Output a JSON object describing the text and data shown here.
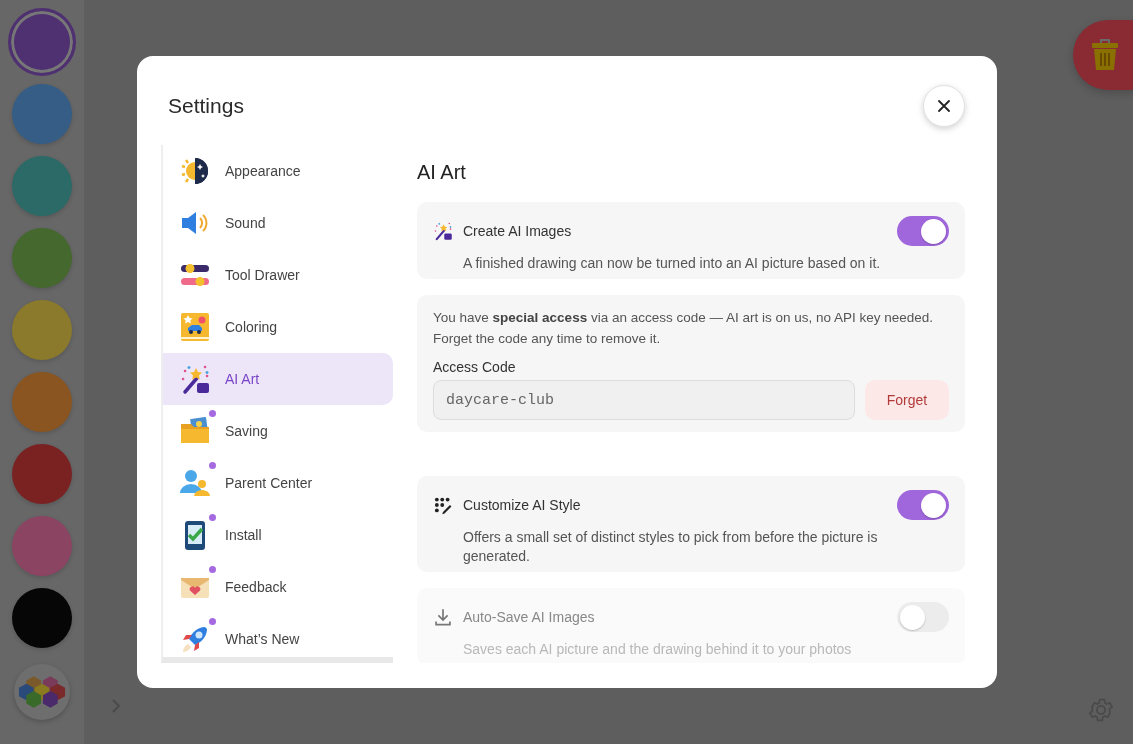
{
  "palette": [
    {
      "color": "#4f3070",
      "selected": true
    },
    {
      "color": "#355d85",
      "selected": false
    },
    {
      "color": "#2b6a66",
      "selected": false
    },
    {
      "color": "#45682f",
      "selected": false
    },
    {
      "color": "#8b7a2b",
      "selected": false
    },
    {
      "color": "#8a5520",
      "selected": false
    },
    {
      "color": "#7a2222",
      "selected": false
    },
    {
      "color": "#8c4463",
      "selected": false
    },
    {
      "color": "#060606",
      "selected": false
    }
  ],
  "dialog": {
    "title": "Settings",
    "sidebar": {
      "items": [
        {
          "label": "Appearance",
          "selected": false,
          "new": false
        },
        {
          "label": "Sound",
          "selected": false,
          "new": false
        },
        {
          "label": "Tool Drawer",
          "selected": false,
          "new": false
        },
        {
          "label": "Coloring",
          "selected": false,
          "new": false
        },
        {
          "label": "AI Art",
          "selected": true,
          "new": false
        },
        {
          "label": "Saving",
          "selected": false,
          "new": true
        },
        {
          "label": "Parent Center",
          "selected": false,
          "new": true
        },
        {
          "label": "Install",
          "selected": false,
          "new": true
        },
        {
          "label": "Feedback",
          "selected": false,
          "new": true
        },
        {
          "label": "What’s New",
          "selected": false,
          "new": true
        }
      ]
    },
    "panel": {
      "title": "AI Art",
      "sections": [
        {
          "kind": "toggle",
          "label": "Create AI Images",
          "description": "A finished drawing can now be turned into an AI picture based on it.",
          "on": true,
          "disabled": false
        },
        {
          "kind": "access",
          "text": "You have **special access** via an access code — AI art is on us, no API key needed. Forget the code any time to remove it.",
          "field_label": "Access Code",
          "value": "daycare-club",
          "button": "Forget"
        },
        {
          "kind": "toggle",
          "label": "Customize AI Style",
          "description": "Offers a small set of distinct styles to pick from before the picture is generated.",
          "on": true,
          "disabled": false
        },
        {
          "kind": "toggle",
          "label": "Auto-Save AI Images",
          "description": "Saves each AI picture and the drawing behind it to your photos",
          "on": false,
          "disabled": true
        }
      ]
    }
  }
}
